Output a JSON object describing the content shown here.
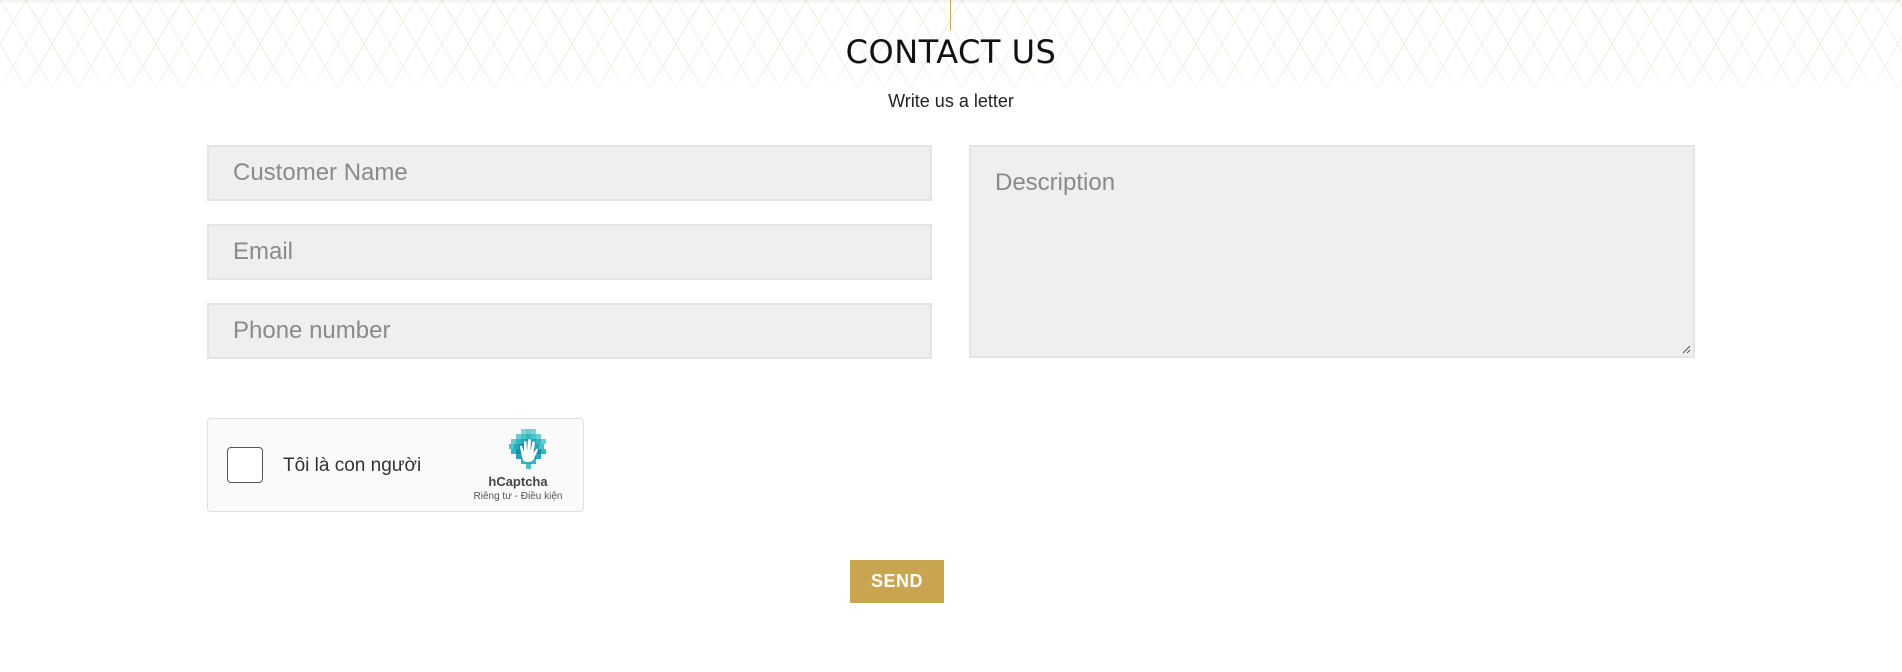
{
  "header": {
    "title": "CONTACT US",
    "subtitle": "Write us a letter"
  },
  "form": {
    "name_placeholder": "Customer Name",
    "email_placeholder": "Email",
    "phone_placeholder": "Phone number",
    "description_placeholder": "Description",
    "send_label": "SEND"
  },
  "captcha": {
    "label": "Tôi là con người",
    "brand": "hCaptcha",
    "links": "Riêng tư - Điều kiện"
  },
  "colors": {
    "accent": "#c9a551",
    "field_bg": "#efefef",
    "pattern": "#ece8d8"
  }
}
